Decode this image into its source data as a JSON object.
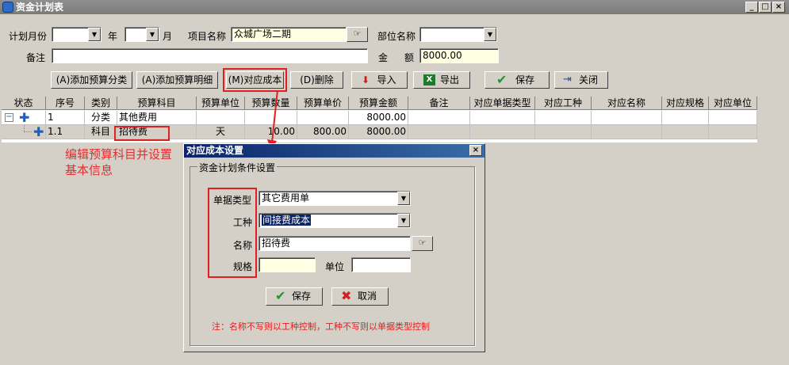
{
  "window": {
    "title": "资金计划表",
    "btn_min": "_",
    "btn_max": "□",
    "btn_close": "×"
  },
  "form": {
    "plan_month_label": "计划月份",
    "year_label": "年",
    "month_label": "月",
    "project_label": "项目名称",
    "project_value": "众城广场二期",
    "dept_label": "部位名称",
    "remark_label": "备注",
    "amount_label_1": "金",
    "amount_label_2": "额",
    "amount_value": "8000.00"
  },
  "toolbar": {
    "add_category": "(A)添加预算分类",
    "add_detail": "(A)添加预算明细",
    "match_cost": "(M)对应成本",
    "delete": "(D)删除",
    "import": "导入",
    "export": "导出",
    "save": "保存",
    "close": "关闭"
  },
  "table": {
    "headers": [
      "状态",
      "序号",
      "类别",
      "预算科目",
      "预算单位",
      "预算数量",
      "预算单价",
      "预算金额",
      "备注",
      "对应单据类型",
      "对应工种",
      "对应名称",
      "对应规格",
      "对应单位"
    ],
    "rows": [
      {
        "expand": "−",
        "seq": "1",
        "type": "分类",
        "subject": "其他费用",
        "unit": "",
        "qty": "",
        "price": "",
        "amount": "8000.00"
      },
      {
        "expand": "",
        "seq": "1.1",
        "type": "科目",
        "subject": "招待费",
        "unit": "天",
        "qty": "10.00",
        "price": "800.00",
        "amount": "8000.00"
      }
    ]
  },
  "annotation": {
    "line1": "编辑预算科目并设置",
    "line2": "基本信息"
  },
  "dialog": {
    "title": "对应成本设置",
    "close": "×",
    "group_title": "资金计划条件设置",
    "doc_type_label": "单据类型",
    "doc_type_value": "其它费用单",
    "work_type_label": "工种",
    "work_type_value": "间接费成本",
    "name_label": "名称",
    "name_value": "招待费",
    "spec_label": "规格",
    "unit_label": "单位",
    "save": "保存",
    "cancel": "取消",
    "note": "注：名称不写则以工种控制，工种不写则以单据类型控制"
  },
  "colors": {
    "annotation_red": "#e03030",
    "highlight_red": "#e02020",
    "dialog_title": "#0a246a",
    "field_yellow": "#ffffe1"
  }
}
